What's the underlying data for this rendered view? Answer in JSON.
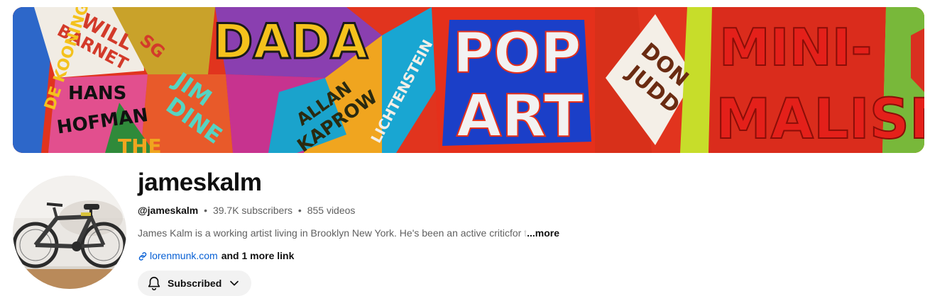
{
  "banner": {
    "words": {
      "dada": "DADA",
      "pop": "POP",
      "art": "ART",
      "don": "DON",
      "judd": "JUDD",
      "mini": "MINI-",
      "malism": "MALISM",
      "will": "WILL",
      "barnet": "BARNET",
      "hans": "HANS",
      "hofman": "HOFMAN",
      "jim": "JIM",
      "dine": "DINE",
      "allan": "ALLAN",
      "kaprow": "KAPROW",
      "lichtenstein": "LICHTENSTEIN",
      "de_kooning": "DE KOONING",
      "the": "THE",
      "sg": "SG"
    }
  },
  "channel": {
    "name": "jameskalm",
    "handle": "@jameskalm",
    "subscribers": "39.7K subscribers",
    "videos": "855 videos",
    "separator": "•",
    "description_visible": "James Kalm is a working artist living in Brooklyn New York. He's been an active critic",
    "description_fade": " for t",
    "more_label": "...more",
    "link_text": "lorenmunk.com",
    "more_links": "and 1 more link",
    "subscribe_label": "Subscribed"
  },
  "icons": {
    "link": "link-icon",
    "bell": "bell-icon",
    "chevron": "chevron-down-icon"
  }
}
